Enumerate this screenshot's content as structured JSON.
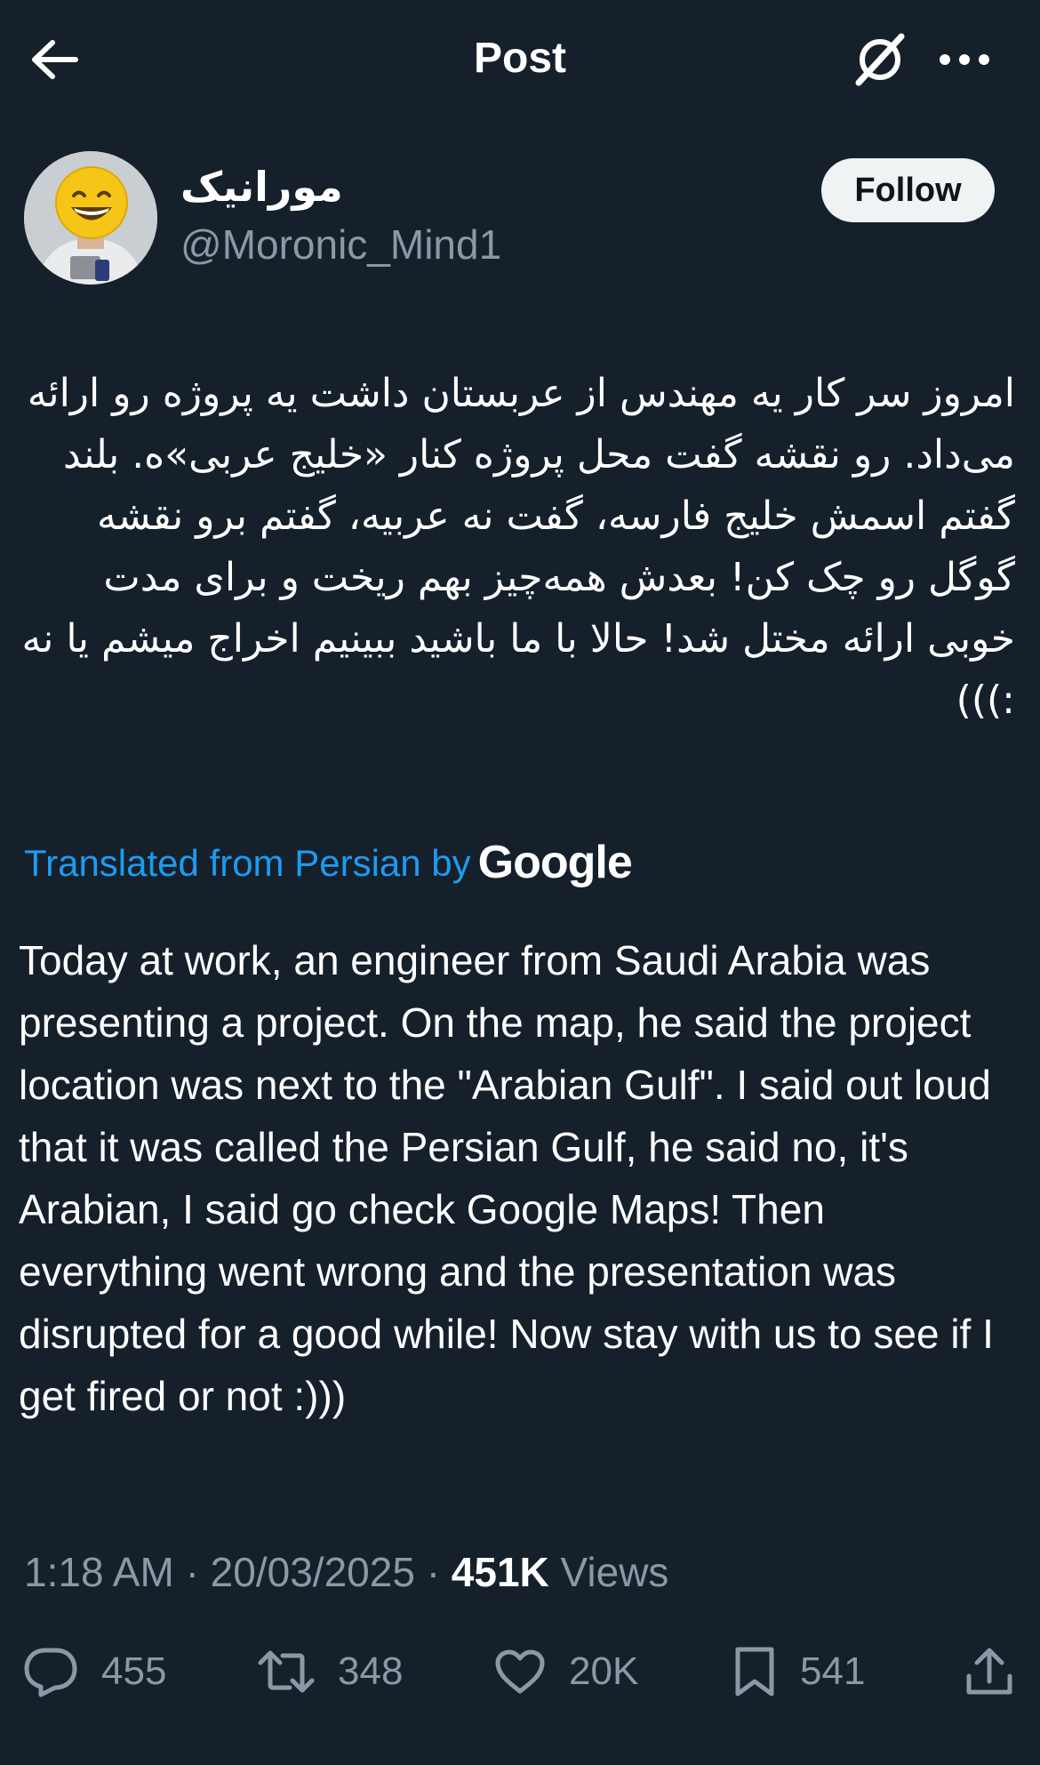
{
  "header": {
    "title": "Post",
    "back_icon": "arrow-left-icon",
    "grok_icon": "grok-icon",
    "more_icon": "more-horizontal-icon"
  },
  "author": {
    "display_name": "مورانیک",
    "handle": "@Moronic_Mind1",
    "follow_label": "Follow"
  },
  "post": {
    "original_text": "امروز سر کار یه مهندس از عربستان داشت یه پروژه رو ارائه می‌داد. رو نقشه گفت محل پروژه کنار «خلیج عربی»ه. بلند گفتم اسمش خلیج فارسه، گفت نه عربیه، گفتم برو نقشه گوگل رو چک کن! بعدش همه‌چیز بهم ریخت و برای مدت خوبی ارائه مختل شد! حالا با ما باشید ببینیم اخراج میشم یا نه :)))",
    "translated_label": "Translated from Persian by",
    "translator": "Google",
    "translated_text": "Today at work, an engineer from Saudi Arabia was presenting a project. On the map, he said the project location was next to the \"Arabian Gulf\". I said out loud that it was called the Persian Gulf, he said no, it's Arabian, I said go check Google Maps! Then everything went wrong and the presentation was disrupted for a good while! Now stay with us to see if I get fired or not :)))"
  },
  "meta": {
    "time": "1:18 AM",
    "separator": "·",
    "date": "20/03/2025",
    "views_count": "451K",
    "views_label": "Views"
  },
  "actions": {
    "replies": "455",
    "reposts": "348",
    "likes": "20K",
    "bookmarks": "541"
  },
  "colors": {
    "background": "#15202b",
    "link": "#1d9bf0",
    "secondary_text": "#8b98a5",
    "follow_button_bg": "#eff3f4"
  }
}
